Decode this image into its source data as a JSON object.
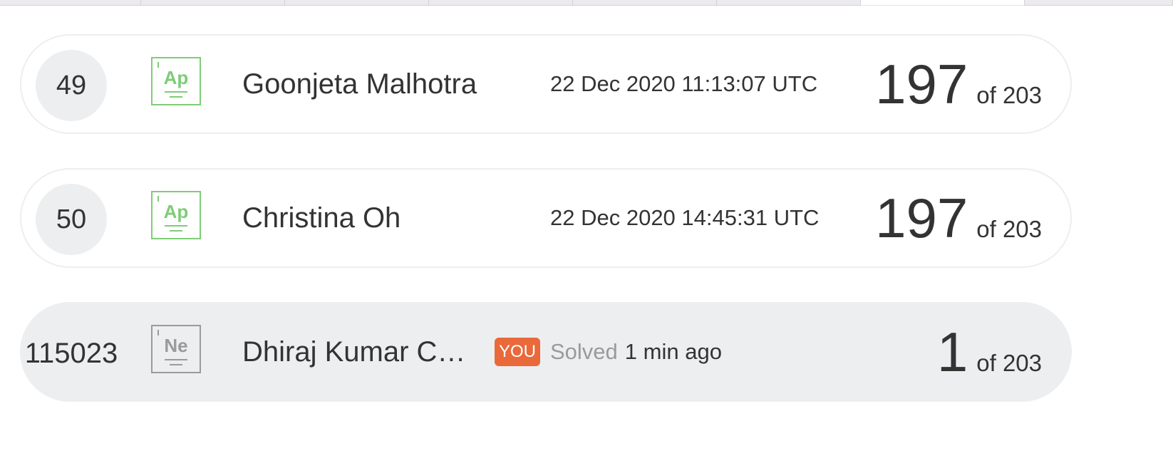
{
  "tabs": [
    {
      "active": false
    },
    {
      "active": false
    },
    {
      "active": false
    },
    {
      "active": false
    },
    {
      "active": false
    },
    {
      "active": false
    },
    {
      "active": true
    },
    {
      "active": false
    }
  ],
  "rows": [
    {
      "rank": "49",
      "badge": {
        "symbol": "Ap",
        "color": "#7fcc76"
      },
      "name": "Goonjeta Malhotra",
      "time": "22 Dec 2020 11:13:07 UTC",
      "score": "197",
      "score_total": "of 203"
    },
    {
      "rank": "50",
      "badge": {
        "symbol": "Ap",
        "color": "#7fcc76"
      },
      "name": "Christina Oh",
      "time": "22 Dec 2020 14:45:31 UTC",
      "score": "197",
      "score_total": "of 203"
    },
    {
      "rank": "115023",
      "badge": {
        "symbol": "Ne",
        "color": "#9a9a9a"
      },
      "name": "Dhiraj Kumar C…",
      "you_label": "YOU",
      "solved_label": "Solved",
      "time": "1 min ago",
      "score": "1",
      "score_total": "of 203"
    }
  ],
  "colors": {
    "you_tag": "#e9693b",
    "current_row_bg": "#eceef0"
  }
}
